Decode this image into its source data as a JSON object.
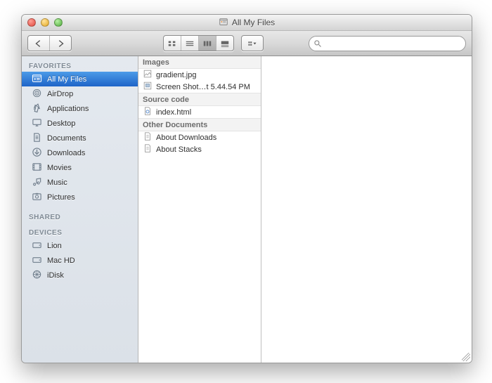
{
  "window": {
    "title": "All My Files"
  },
  "search": {
    "placeholder": ""
  },
  "sidebar": {
    "sections": [
      {
        "header": "FAVORITES",
        "items": [
          {
            "icon": "all-my-files-icon",
            "label": "All My Files",
            "selected": true
          },
          {
            "icon": "airdrop-icon",
            "label": "AirDrop"
          },
          {
            "icon": "applications-icon",
            "label": "Applications"
          },
          {
            "icon": "desktop-icon",
            "label": "Desktop"
          },
          {
            "icon": "documents-icon",
            "label": "Documents"
          },
          {
            "icon": "downloads-icon",
            "label": "Downloads"
          },
          {
            "icon": "movies-icon",
            "label": "Movies"
          },
          {
            "icon": "music-icon",
            "label": "Music"
          },
          {
            "icon": "pictures-icon",
            "label": "Pictures"
          }
        ]
      },
      {
        "header": "SHARED",
        "items": []
      },
      {
        "header": "DEVICES",
        "items": [
          {
            "icon": "disk-icon",
            "label": "Lion"
          },
          {
            "icon": "disk-icon",
            "label": "Mac HD"
          },
          {
            "icon": "idisk-icon",
            "label": "iDisk"
          }
        ]
      }
    ]
  },
  "content": {
    "categories": [
      {
        "label": "Images",
        "files": [
          {
            "icon": "image-file-icon",
            "name": "gradient.jpg"
          },
          {
            "icon": "image-file-icon",
            "name": "Screen Shot…t 5.44.54 PM"
          }
        ]
      },
      {
        "label": "Source code",
        "files": [
          {
            "icon": "html-file-icon",
            "name": "index.html"
          }
        ]
      },
      {
        "label": "Other Documents",
        "files": [
          {
            "icon": "text-file-icon",
            "name": "About Downloads"
          },
          {
            "icon": "text-file-icon",
            "name": "About Stacks"
          }
        ]
      }
    ]
  }
}
